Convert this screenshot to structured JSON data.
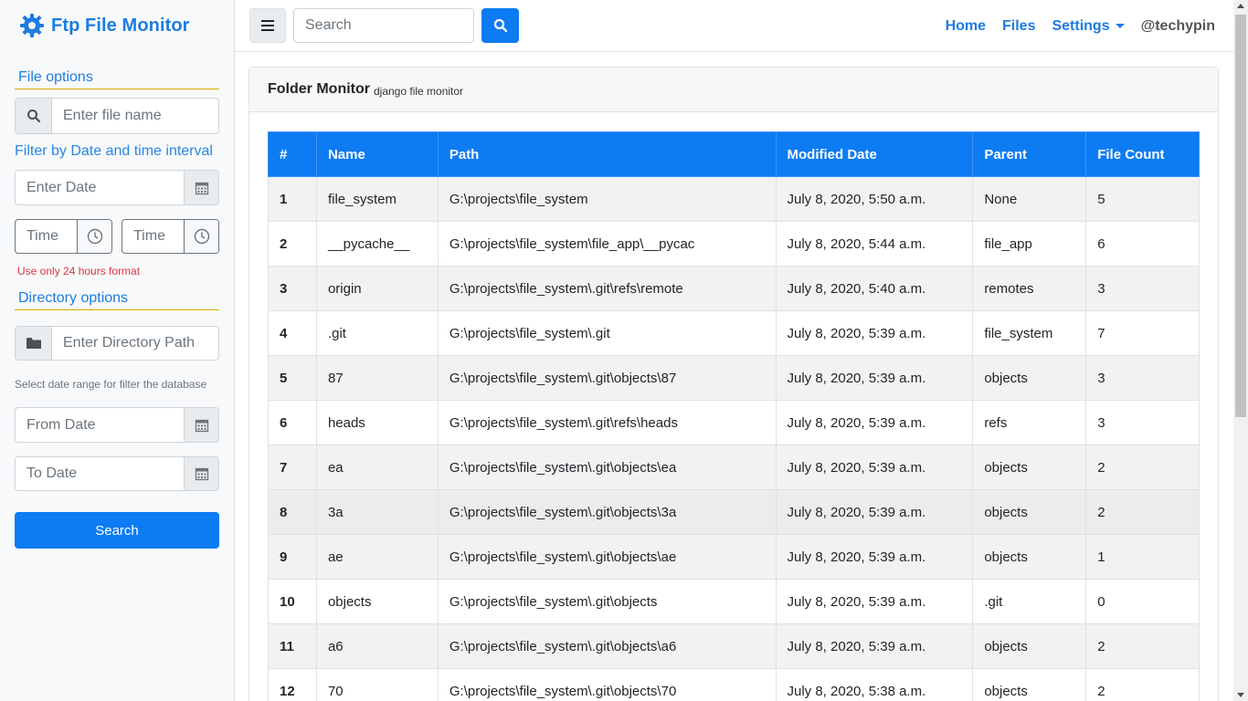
{
  "brand": {
    "title": "Ftp File Monitor",
    "icon": "gear-cog-icon"
  },
  "sidebar": {
    "file_options_title": "File options",
    "file_name_placeholder": "Enter file name",
    "filter_label": "Filter by Date and time interval",
    "date_placeholder": "Enter Date",
    "time_from_placeholder": "Time",
    "time_to_placeholder": "Time",
    "time_hint": "Use only 24 hours format",
    "directory_options_title": "Directory options",
    "directory_placeholder": "Enter Directory Path",
    "range_hint": "Select date range for filter the database",
    "from_date_placeholder": "From Date",
    "to_date_placeholder": "To Date",
    "search_button": "Search"
  },
  "topnav": {
    "search_placeholder": "Search",
    "links": {
      "home": "Home",
      "files": "Files",
      "settings": "Settings",
      "user": "@techypin"
    }
  },
  "card": {
    "title": "Folder Monitor",
    "subtitle": "django file monitor"
  },
  "table": {
    "headers": [
      "#",
      "Name",
      "Path",
      "Modified Date",
      "Parent",
      "File Count"
    ],
    "rows": [
      {
        "id": "1",
        "name": "file_system",
        "path": "G:\\projects\\file_system",
        "date": "July 8, 2020, 5:50 a.m.",
        "parent": "None",
        "count": "5"
      },
      {
        "id": "2",
        "name": "__pycache__",
        "path": "G:\\projects\\file_system\\file_app\\__pycac",
        "date": "July 8, 2020, 5:44 a.m.",
        "parent": "file_app",
        "count": "6"
      },
      {
        "id": "3",
        "name": "origin",
        "path": "G:\\projects\\file_system\\.git\\refs\\remote",
        "date": "July 8, 2020, 5:40 a.m.",
        "parent": "remotes",
        "count": "3"
      },
      {
        "id": "4",
        "name": ".git",
        "path": "G:\\projects\\file_system\\.git",
        "date": "July 8, 2020, 5:39 a.m.",
        "parent": "file_system",
        "count": "7"
      },
      {
        "id": "5",
        "name": "87",
        "path": "G:\\projects\\file_system\\.git\\objects\\87",
        "date": "July 8, 2020, 5:39 a.m.",
        "parent": "objects",
        "count": "3"
      },
      {
        "id": "6",
        "name": "heads",
        "path": "G:\\projects\\file_system\\.git\\refs\\heads",
        "date": "July 8, 2020, 5:39 a.m.",
        "parent": "refs",
        "count": "3"
      },
      {
        "id": "7",
        "name": "ea",
        "path": "G:\\projects\\file_system\\.git\\objects\\ea",
        "date": "July 8, 2020, 5:39 a.m.",
        "parent": "objects",
        "count": "2"
      },
      {
        "id": "8",
        "name": "3a",
        "path": "G:\\projects\\file_system\\.git\\objects\\3a",
        "date": "July 8, 2020, 5:39 a.m.",
        "parent": "objects",
        "count": "2"
      },
      {
        "id": "9",
        "name": "ae",
        "path": "G:\\projects\\file_system\\.git\\objects\\ae",
        "date": "July 8, 2020, 5:39 a.m.",
        "parent": "objects",
        "count": "1"
      },
      {
        "id": "10",
        "name": "objects",
        "path": "G:\\projects\\file_system\\.git\\objects",
        "date": "July 8, 2020, 5:39 a.m.",
        "parent": ".git",
        "count": "0"
      },
      {
        "id": "11",
        "name": "a6",
        "path": "G:\\projects\\file_system\\.git\\objects\\a6",
        "date": "July 8, 2020, 5:39 a.m.",
        "parent": "objects",
        "count": "2"
      },
      {
        "id": "12",
        "name": "70",
        "path": "G:\\projects\\file_system\\.git\\objects\\70",
        "date": "July 8, 2020, 5:38 a.m.",
        "parent": "objects",
        "count": "2"
      }
    ]
  },
  "colors": {
    "primary": "#0d7bf2",
    "brand": "#1d7ce0",
    "danger": "#dc3545",
    "section_underline": "#e0a800"
  }
}
